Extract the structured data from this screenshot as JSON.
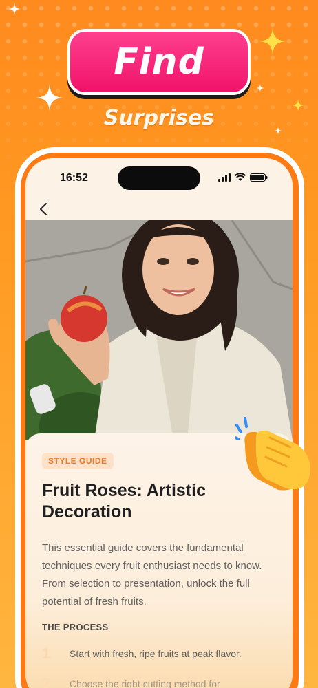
{
  "headline": {
    "find": "Find",
    "subtitle": "Surprises"
  },
  "status_bar": {
    "time": "16:52"
  },
  "article": {
    "tag": "STYLE GUIDE",
    "title": "Fruit Roses: Artistic Decoration",
    "intro": "This essential guide covers the fundamental techniques every fruit enthusiast needs to know. From selection to presentation, unlock the full potential of fresh fruits.",
    "section_heading": "THE PROCESS",
    "steps": [
      {
        "num": "1",
        "text": "Start with fresh, ripe fruits at peak flavor."
      },
      {
        "num": "2",
        "text": "Choose the right cutting method for"
      }
    ]
  },
  "icons": {
    "back": "chevron-left-icon",
    "signal": "signal-icon",
    "wifi": "wifi-icon",
    "battery": "battery-icon",
    "clap": "clapping-hands-icon",
    "sparkle": "sparkle-icon"
  },
  "colors": {
    "background": "#ff8a1e",
    "pill": "#f0136a",
    "tag_text": "#f07a2c",
    "tag_bg": "#fde2c9",
    "frame": "#ff7a14"
  }
}
